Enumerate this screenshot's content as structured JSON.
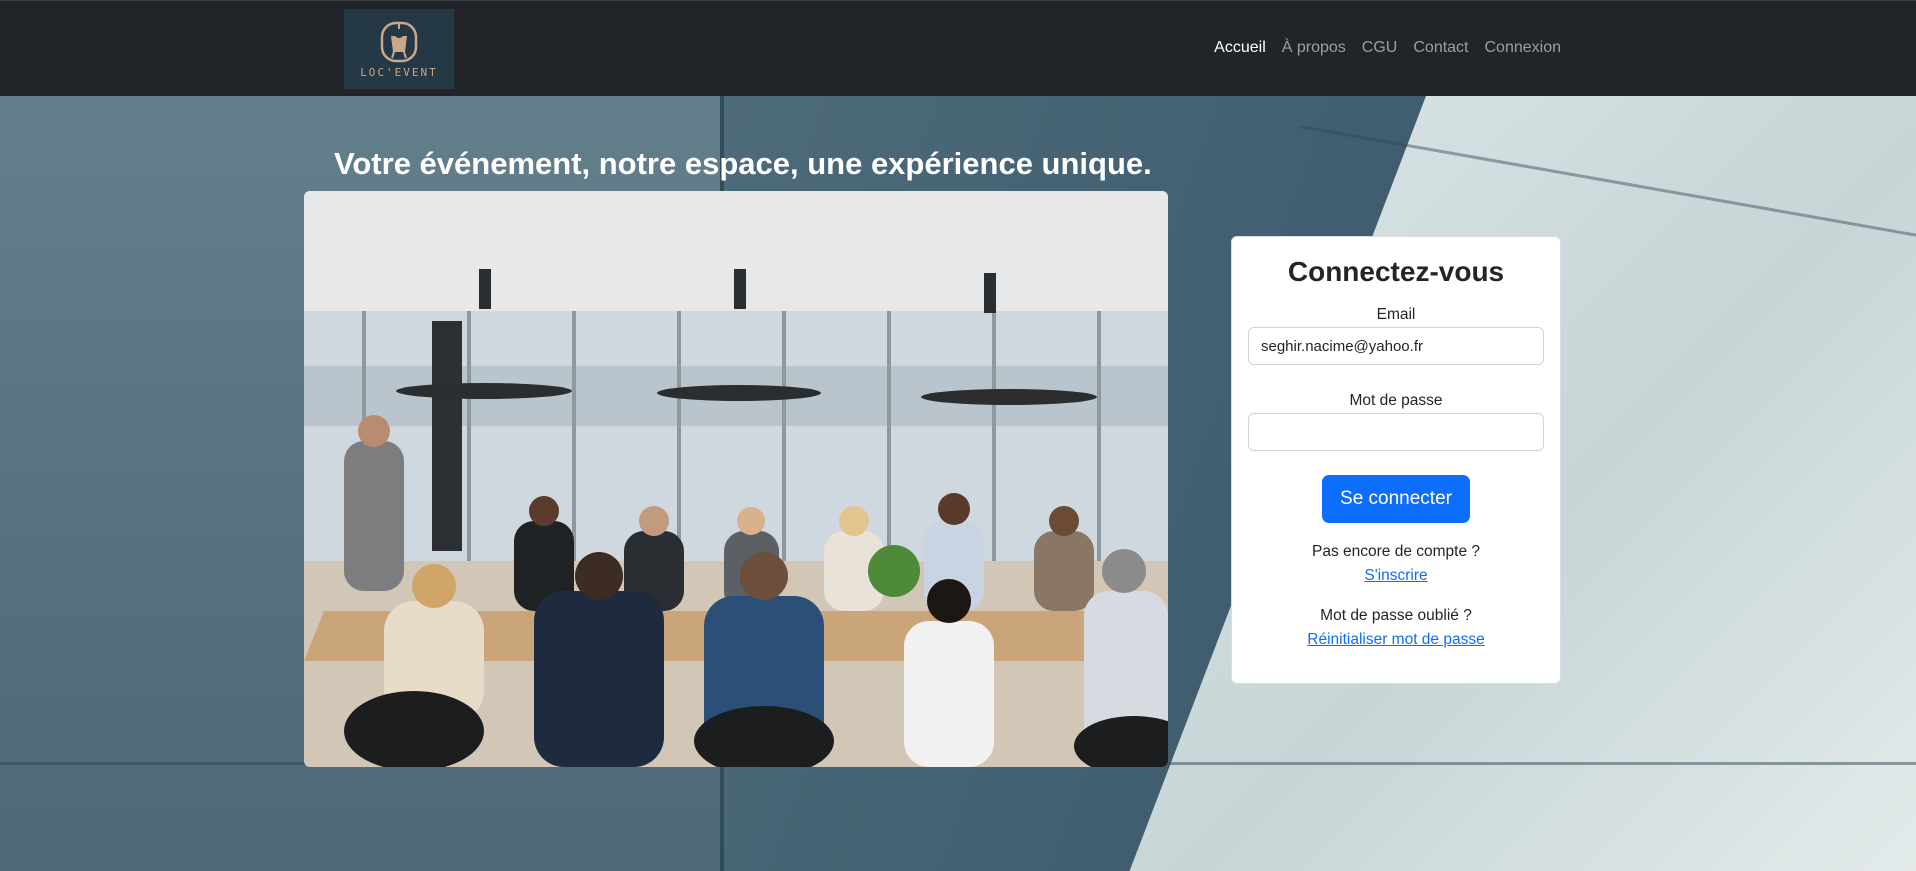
{
  "brand": {
    "name": "LOC'EVENT",
    "logo_icon": "chair-lamp-icon",
    "accent": "#c8a98a"
  },
  "navbar": {
    "links": [
      {
        "label": "Accueil",
        "active": true
      },
      {
        "label": "À propos",
        "active": false
      },
      {
        "label": "CGU",
        "active": false
      },
      {
        "label": "Contact",
        "active": false
      },
      {
        "label": "Connexion",
        "active": false
      }
    ]
  },
  "hero": {
    "title": "Votre événement, notre espace, une expérience unique."
  },
  "login": {
    "title": "Connectez-vous",
    "email_label": "Email",
    "email_value": "seghir.nacime@yahoo.fr",
    "password_label": "Mot de passe",
    "password_value": "",
    "submit_label": "Se connecter",
    "no_account_text": "Pas encore de compte ?",
    "signup_link": "S'inscrire",
    "forgot_text": "Mot de passe oublié ?",
    "reset_link": "Réinitialiser mot de passe"
  },
  "colors": {
    "navbar_bg": "#212529",
    "primary": "#0d6efd"
  }
}
